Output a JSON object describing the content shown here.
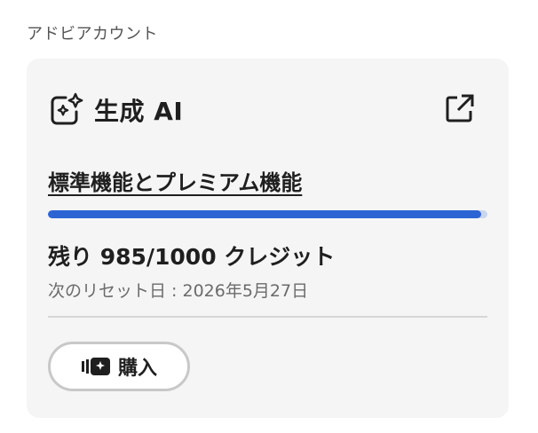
{
  "section": {
    "title": "アドビアカウント"
  },
  "card": {
    "title": "生成 AI",
    "icon": "generative-ai-sparkle-icon",
    "external_link_icon": "external-link-icon",
    "plan_link": "標準機能とプレミアム機能",
    "credits": {
      "remaining": 985,
      "total": 1000,
      "used_fraction": 0.985,
      "remaining_label": "残り 985/1000 クレジット"
    },
    "reset_label": "次のリセット日 : 2026年5月27日",
    "buy_button": {
      "label": "購入",
      "icon": "credits-icon"
    }
  },
  "colors": {
    "progress_fill": "#2d64d4",
    "progress_track": "#c9d6ee",
    "card_background": "#f5f5f5"
  }
}
